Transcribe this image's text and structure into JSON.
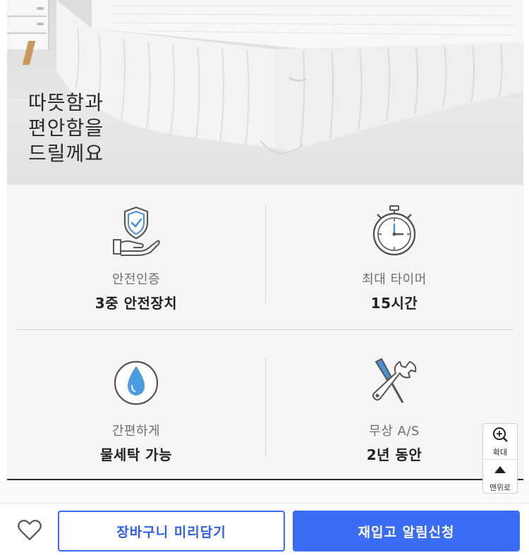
{
  "hero": {
    "lines": [
      "따뜻함과",
      "편안함을",
      "드릴께요"
    ]
  },
  "features": [
    {
      "icon": "shield-hand-icon",
      "sub": "안전인증",
      "main": "3중 안전장치"
    },
    {
      "icon": "stopwatch-icon",
      "sub": "최대 타이머",
      "main": "15시간"
    },
    {
      "icon": "water-drop-icon",
      "sub": "간편하게",
      "main": "물세탁 가능"
    },
    {
      "icon": "tools-icon",
      "sub": "무상 A/S",
      "main": "2년 동안"
    }
  ],
  "side_buttons": {
    "zoom_label": "확대",
    "top_label": "맨위로"
  },
  "bottom_bar": {
    "cart_label": "장바구니 미리담기",
    "notify_label": "재입고 알림신청"
  },
  "colors": {
    "accent": "#3a6cf4",
    "panel_bg": "#f5f5f5"
  }
}
